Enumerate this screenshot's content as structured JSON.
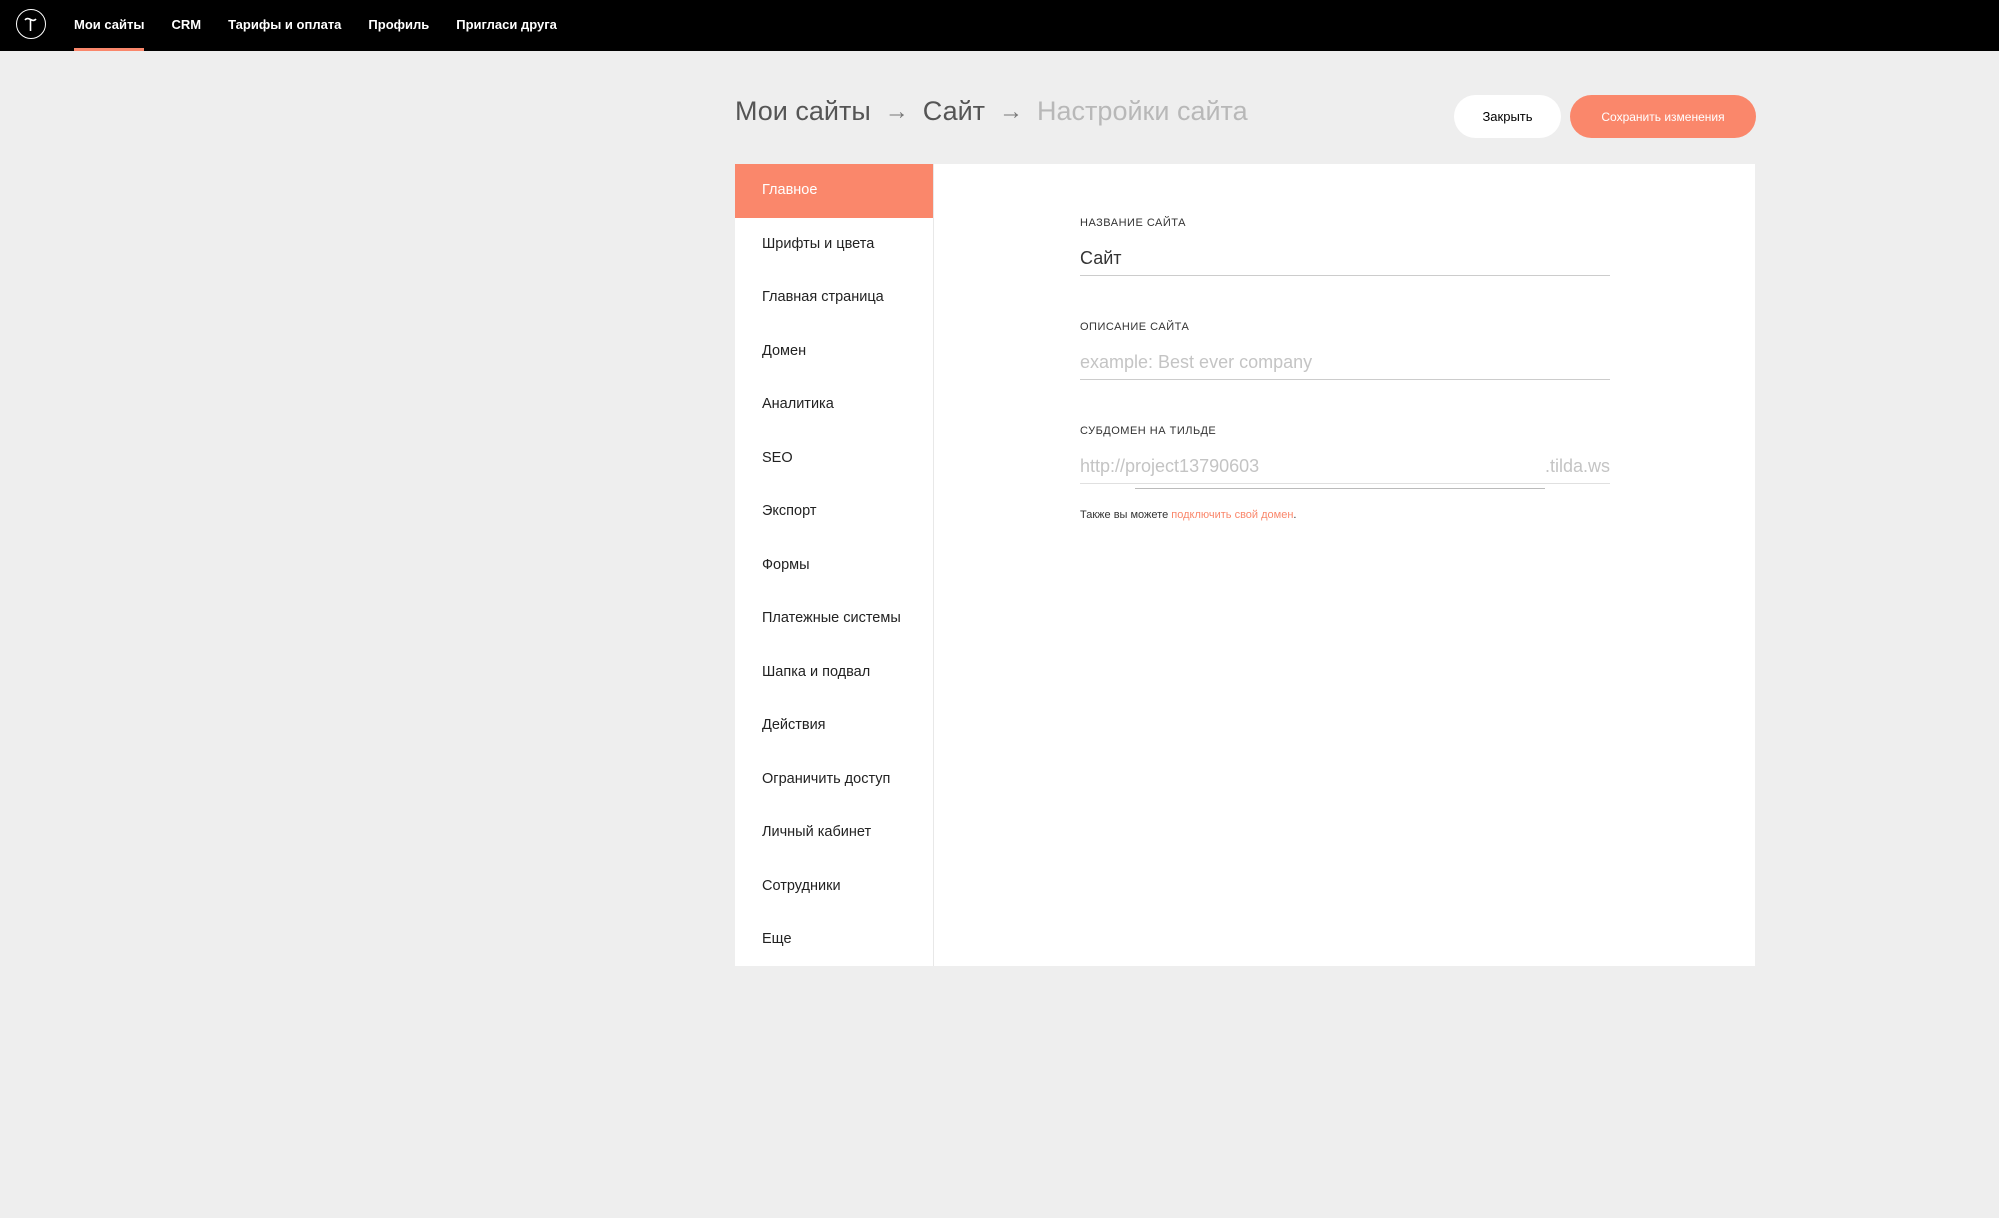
{
  "topbar": {
    "logo_icon": "tilda-logo-icon",
    "nav": [
      {
        "label": "Мои сайты",
        "active": true
      },
      {
        "label": "CRM",
        "active": false
      },
      {
        "label": "Тарифы и оплата",
        "active": false
      },
      {
        "label": "Профиль",
        "active": false
      },
      {
        "label": "Пригласи друга",
        "active": false
      }
    ]
  },
  "breadcrumb": {
    "items": [
      "Мои сайты",
      "Сайт"
    ],
    "separator": "→",
    "current": "Настройки сайта"
  },
  "actions": {
    "close_label": "Закрыть",
    "save_label": "Сохранить изменения"
  },
  "sidebar": {
    "items": [
      {
        "label": "Главное",
        "active": true
      },
      {
        "label": "Шрифты и цвета",
        "active": false
      },
      {
        "label": "Главная страница",
        "active": false
      },
      {
        "label": "Домен",
        "active": false
      },
      {
        "label": "Аналитика",
        "active": false
      },
      {
        "label": "SEO",
        "active": false
      },
      {
        "label": "Экспорт",
        "active": false
      },
      {
        "label": "Формы",
        "active": false
      },
      {
        "label": "Платежные системы",
        "active": false
      },
      {
        "label": "Шапка и подвал",
        "active": false
      },
      {
        "label": "Действия",
        "active": false
      },
      {
        "label": "Ограничить доступ",
        "active": false
      },
      {
        "label": "Личный кабинет",
        "active": false
      },
      {
        "label": "Сотрудники",
        "active": false
      },
      {
        "label": "Еще",
        "active": false
      }
    ]
  },
  "form": {
    "site_name": {
      "label": "НАЗВАНИЕ САЙТА",
      "value": "Сайт"
    },
    "site_description": {
      "label": "ОПИСАНИЕ САЙТА",
      "value": "",
      "placeholder": "example: Best ever company"
    },
    "subdomain": {
      "label": "СУБДОМЕН НА ТИЛЬДЕ",
      "value": "",
      "placeholder": "http://project13790603",
      "suffix": ".tilda.ws"
    },
    "hint": {
      "text": "Также вы можете",
      "link": "подключить свой домен",
      "end": "."
    }
  },
  "colors": {
    "accent": "#fa876b",
    "topbar": "#000000",
    "background": "#eeeeee"
  }
}
